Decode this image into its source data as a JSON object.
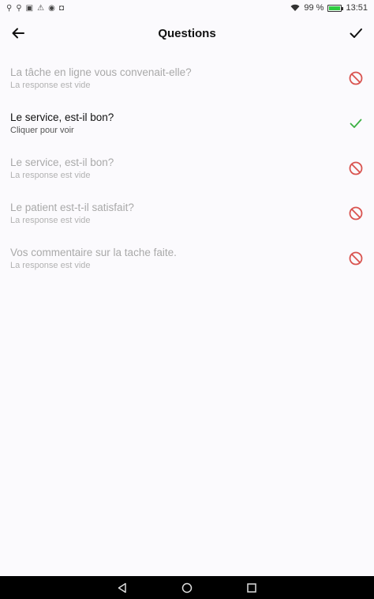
{
  "status_bar": {
    "battery_percent": "99 %",
    "battery_level": 0.99,
    "time": "13:51",
    "notification_icons": [
      "usb-icon",
      "usb-icon",
      "image-icon",
      "warning-icon",
      "pinterest-icon",
      "app-icon"
    ]
  },
  "app_bar": {
    "title": "Questions",
    "back_icon": "arrow-left-icon",
    "confirm_icon": "check-icon"
  },
  "questions": [
    {
      "question": "La tâche en ligne vous convenait-elle?",
      "subtitle": "La response est vide",
      "state": "empty"
    },
    {
      "question": "Le service, est-il bon?",
      "subtitle": "Cliquer pour voir",
      "state": "answered"
    },
    {
      "question": "Le service, est-il bon?",
      "subtitle": "La response est vide",
      "state": "empty"
    },
    {
      "question": "Le patient est-t-il satisfait?",
      "subtitle": "La response est vide",
      "state": "empty"
    },
    {
      "question": "Vos commentaire sur la tache faite.",
      "subtitle": "La response est vide",
      "state": "empty"
    }
  ],
  "colors": {
    "empty_icon": "#d9534f",
    "answered_icon": "#3cb043",
    "background": "#fbfafd",
    "disabled_text": "#a9a9a9"
  },
  "nav_bar": {
    "back_icon": "nav-back-icon",
    "home_icon": "nav-home-icon",
    "recents_icon": "nav-recents-icon"
  }
}
